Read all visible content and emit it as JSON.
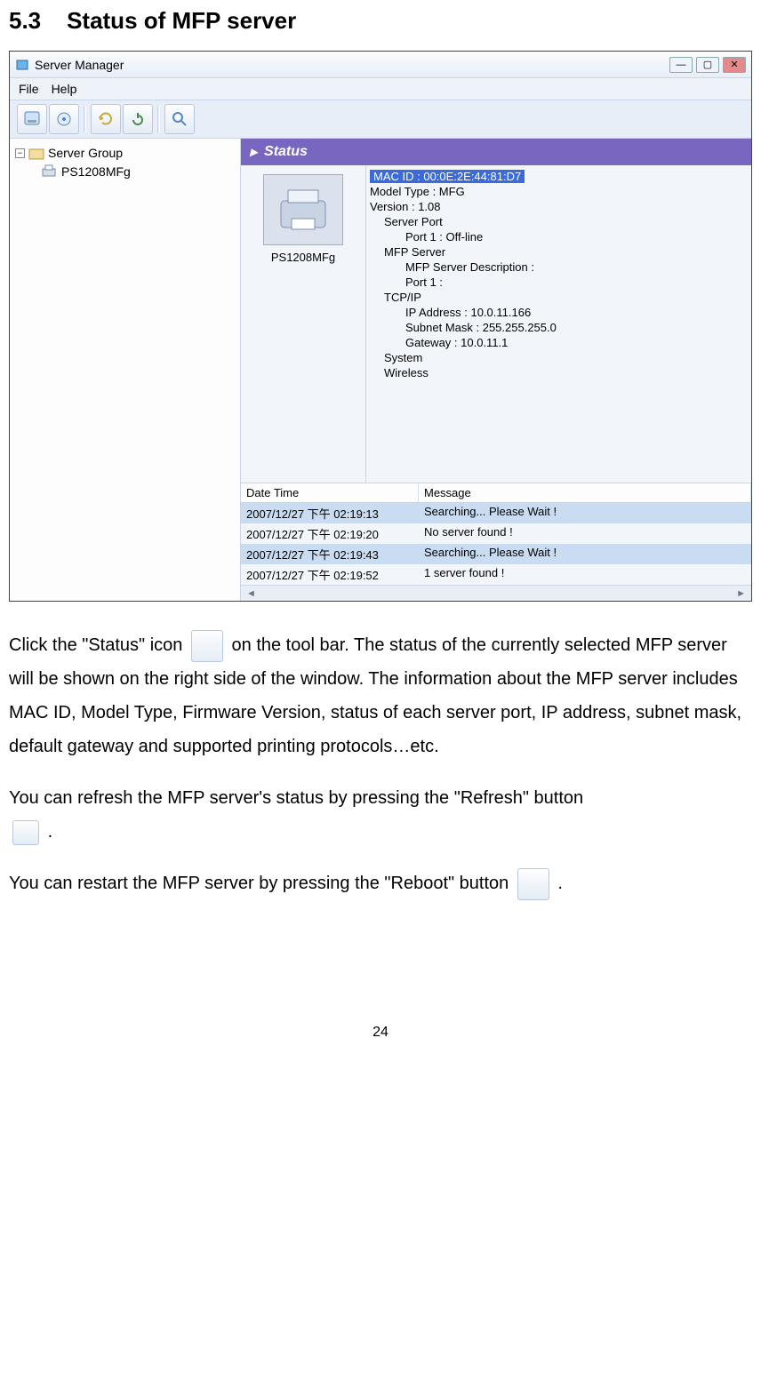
{
  "section": {
    "number": "5.3",
    "title": "Status of MFP server"
  },
  "window": {
    "title": "Server Manager",
    "menus": {
      "file": "File",
      "help": "Help"
    },
    "tree": {
      "root": "Server Group",
      "child": "PS1208MFg"
    },
    "status_label": "Status",
    "printer_name": "PS1208MFg",
    "info": {
      "mac": "MAC ID : 00:0E:2E:44:81:D7",
      "model": "Model Type : MFG",
      "version": "Version : 1.08",
      "server_port": "Server Port",
      "port1_offline": "Port 1 : Off-line",
      "mfp_server": "MFP Server",
      "mfp_desc": "MFP Server Description :",
      "port1": "Port 1 :",
      "tcpip": "TCP/IP",
      "ip": "IP Address : 10.0.11.166",
      "subnet": "Subnet Mask : 255.255.255.0",
      "gateway": "Gateway : 10.0.11.1",
      "system": "System",
      "wireless": "Wireless"
    },
    "log_headers": {
      "dt": "Date Time",
      "msg": "Message"
    },
    "logs": [
      {
        "dt": "2007/12/27 下午 02:19:13",
        "msg": "Searching... Please Wait !",
        "sel": true
      },
      {
        "dt": "2007/12/27 下午 02:19:20",
        "msg": "No server found !",
        "sel": false
      },
      {
        "dt": "2007/12/27 下午 02:19:43",
        "msg": "Searching... Please Wait !",
        "sel": true
      },
      {
        "dt": "2007/12/27 下午 02:19:52",
        "msg": "1 server found !",
        "sel": false
      }
    ]
  },
  "para": {
    "p1a": "Click the \"Status\" icon ",
    "p1b": " on the tool bar. The status of the currently selected MFP server will be shown on the right side of the window. The information about the MFP server includes MAC ID, Model Type, Firmware Version, status of each server port, IP address, subnet mask, default gateway and supported printing protocols…etc.",
    "p2a": "You can refresh the MFP server's status by pressing the \"Refresh\" button ",
    "p2b": ".",
    "p3a": "You can restart the MFP server by pressing the \"Reboot\" button ",
    "p3b": "."
  },
  "page_number": "24"
}
